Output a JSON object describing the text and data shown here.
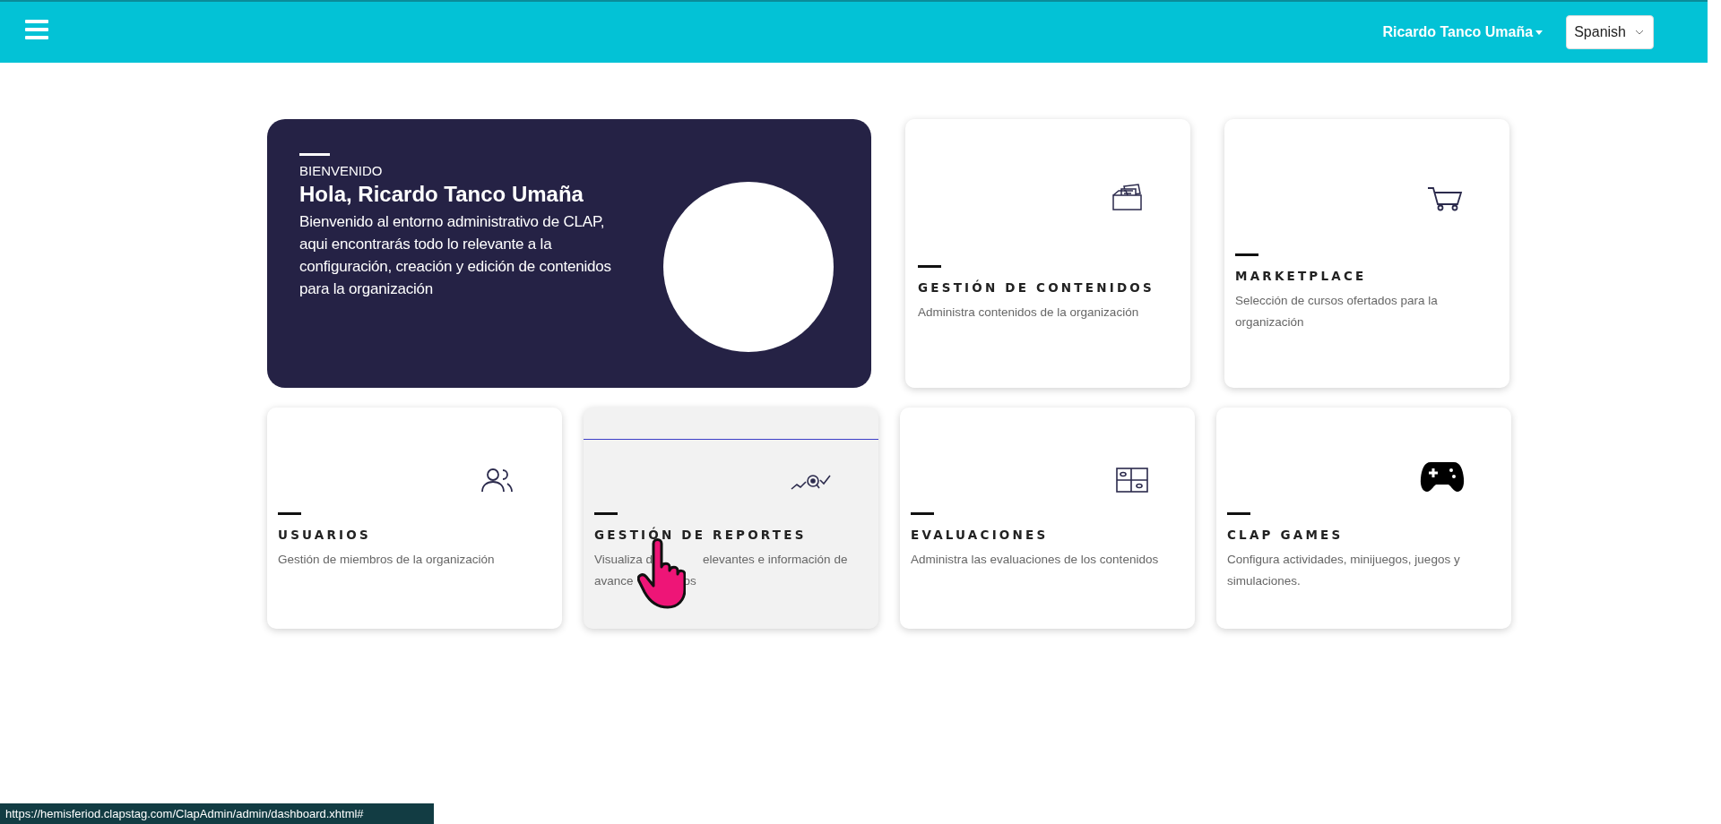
{
  "header": {
    "user_menu": "Ricardo Tanco Umaña",
    "language": "Spanish"
  },
  "welcome": {
    "eyebrow": "BIENVENIDO",
    "heading": "Hola, Ricardo Tanco Umaña",
    "text": "Bienvenido al entorno administrativo de CLAP, aqui encontrarás todo lo relevante a la configuración, creación y edición de contenidos para la organización"
  },
  "top_cards": [
    {
      "title": "GESTIÓN DE CONTENIDOS",
      "description": "Administra contenidos de la organización",
      "hovered": false
    },
    {
      "title": "MARKETPLACE",
      "description": "Selección de cursos ofertados para la organización",
      "hovered": false
    }
  ],
  "bottom_cards": [
    {
      "title": "USUARIOS",
      "description": "Gestión de miembros de la organización",
      "hovered": false
    },
    {
      "title": "GESTIÓN DE REPORTES",
      "description_fragments": [
        [
          "Visualiza d",
          "elevantes e información de"
        ],
        [
          "avance",
          "os"
        ]
      ],
      "hovered": true
    },
    {
      "title": "EVALUACIONES",
      "description": "Administra las evaluaciones de los contenidos",
      "hovered": false
    },
    {
      "title": "CLAP GAMES",
      "description": "Configura actividades, minijuegos, juegos y simulaciones.",
      "hovered": false
    }
  ],
  "status_bar": {
    "url": "https://hemisferiod.clapstag.com/ClapAdmin/admin/dashboard.xhtml#"
  }
}
